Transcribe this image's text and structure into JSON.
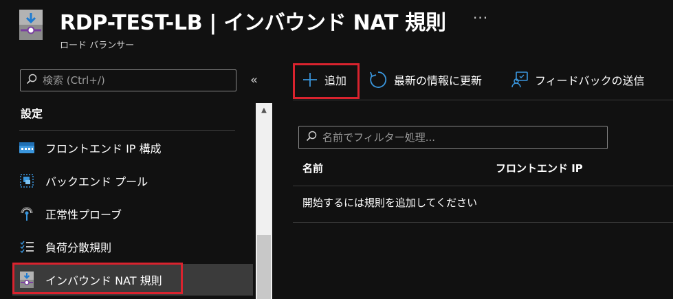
{
  "header": {
    "title": "RDP-TEST-LB | インバウンド NAT 規則",
    "subtitle": "ロード バランサー",
    "more": "···"
  },
  "sidebar": {
    "search_placeholder": "検索 (Ctrl+/)",
    "collapse": "«",
    "section_title": "設定",
    "items": [
      {
        "label": "フロントエンド IP 構成",
        "icon": "frontend-ip-icon"
      },
      {
        "label": "バックエンド プール",
        "icon": "backend-pool-icon"
      },
      {
        "label": "正常性プローブ",
        "icon": "health-probe-icon"
      },
      {
        "label": "負荷分散規則",
        "icon": "load-balancing-rules-icon"
      },
      {
        "label": "インバウンド NAT 規則",
        "icon": "inbound-nat-icon",
        "selected": true
      }
    ]
  },
  "toolbar": {
    "add_label": "追加",
    "refresh_label": "最新の情報に更新",
    "feedback_label": "フィードバックの送信"
  },
  "main": {
    "filter_placeholder": "名前でフィルター処理...",
    "columns": [
      "名前",
      "フロントエンド IP"
    ],
    "empty_message": "開始するには規則を追加してください"
  },
  "colors": {
    "background": "#111111",
    "highlight": "#d9232e",
    "accent": "#3a96dd",
    "selected_bg": "#3b3b3b"
  }
}
